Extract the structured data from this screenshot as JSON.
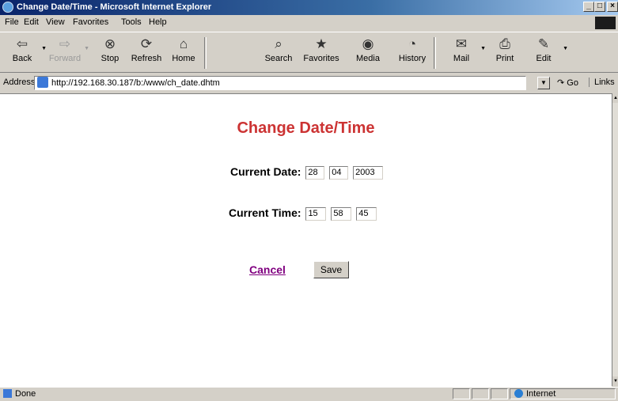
{
  "window": {
    "title": "Change Date/Time - Microsoft Internet Explorer"
  },
  "menu": {
    "items": [
      "File",
      "Edit",
      "View",
      "Favorites",
      "Tools",
      "Help"
    ]
  },
  "toolbar": {
    "back": "Back",
    "forward": "Forward",
    "stop": "Stop",
    "refresh": "Refresh",
    "home": "Home",
    "search": "Search",
    "favorites": "Favorites",
    "media": "Media",
    "history": "History",
    "mail": "Mail",
    "print": "Print",
    "edit": "Edit"
  },
  "address": {
    "label": "Address",
    "url": "http://192.168.30.187/b:/www/ch_date.dhtm",
    "go": "Go",
    "links": "Links"
  },
  "page": {
    "title": "Change Date/Time",
    "date_label": "Current Date:",
    "date": {
      "day": "28",
      "month": "04",
      "year": "2003"
    },
    "time_label": "Current Time:",
    "time": {
      "hour": "15",
      "minute": "58",
      "second": "45"
    },
    "cancel": "Cancel",
    "save": "Save"
  },
  "status": {
    "text": "Done",
    "zone": "Internet"
  },
  "icons": {
    "back": "back-arrow-icon",
    "forward": "forward-arrow-icon",
    "stop": "stop-icon",
    "refresh": "refresh-icon",
    "home": "home-icon",
    "search": "search-icon",
    "favorites": "favorites-icon",
    "media": "media-icon",
    "history": "history-icon",
    "mail": "mail-icon",
    "print": "print-icon",
    "edit": "edit-icon"
  },
  "colors": {
    "title_bar": "#0a246a",
    "page_title": "#cc3333",
    "link_visited": "#800080",
    "chrome": "#d4d0c8"
  }
}
